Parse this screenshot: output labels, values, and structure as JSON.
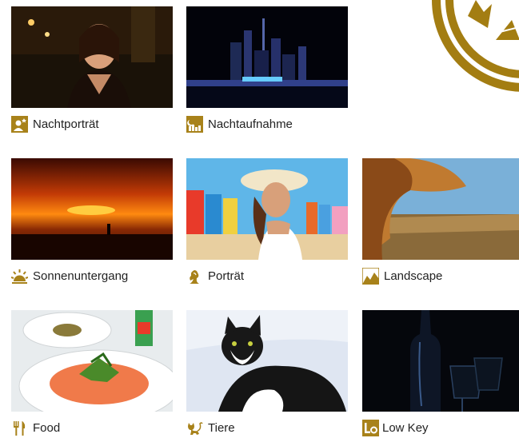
{
  "modes": [
    {
      "label": "Nachtporträt",
      "icon": "night-portrait-icon"
    },
    {
      "label": "Nachtaufnahme",
      "icon": "night-scene-icon"
    },
    {
      "label": "Sonnenuntergang",
      "icon": "sunset-icon"
    },
    {
      "label": "Porträt",
      "icon": "portrait-icon"
    },
    {
      "label": "Landscape",
      "icon": "landscape-icon"
    },
    {
      "label": "Food",
      "icon": "food-icon"
    },
    {
      "label": "Tiere",
      "icon": "pet-icon"
    },
    {
      "label": "Low Key",
      "icon": "low-key-icon"
    }
  ],
  "colors": {
    "icon_gold": "#a8821a",
    "dial_gold": "#a37d12"
  }
}
